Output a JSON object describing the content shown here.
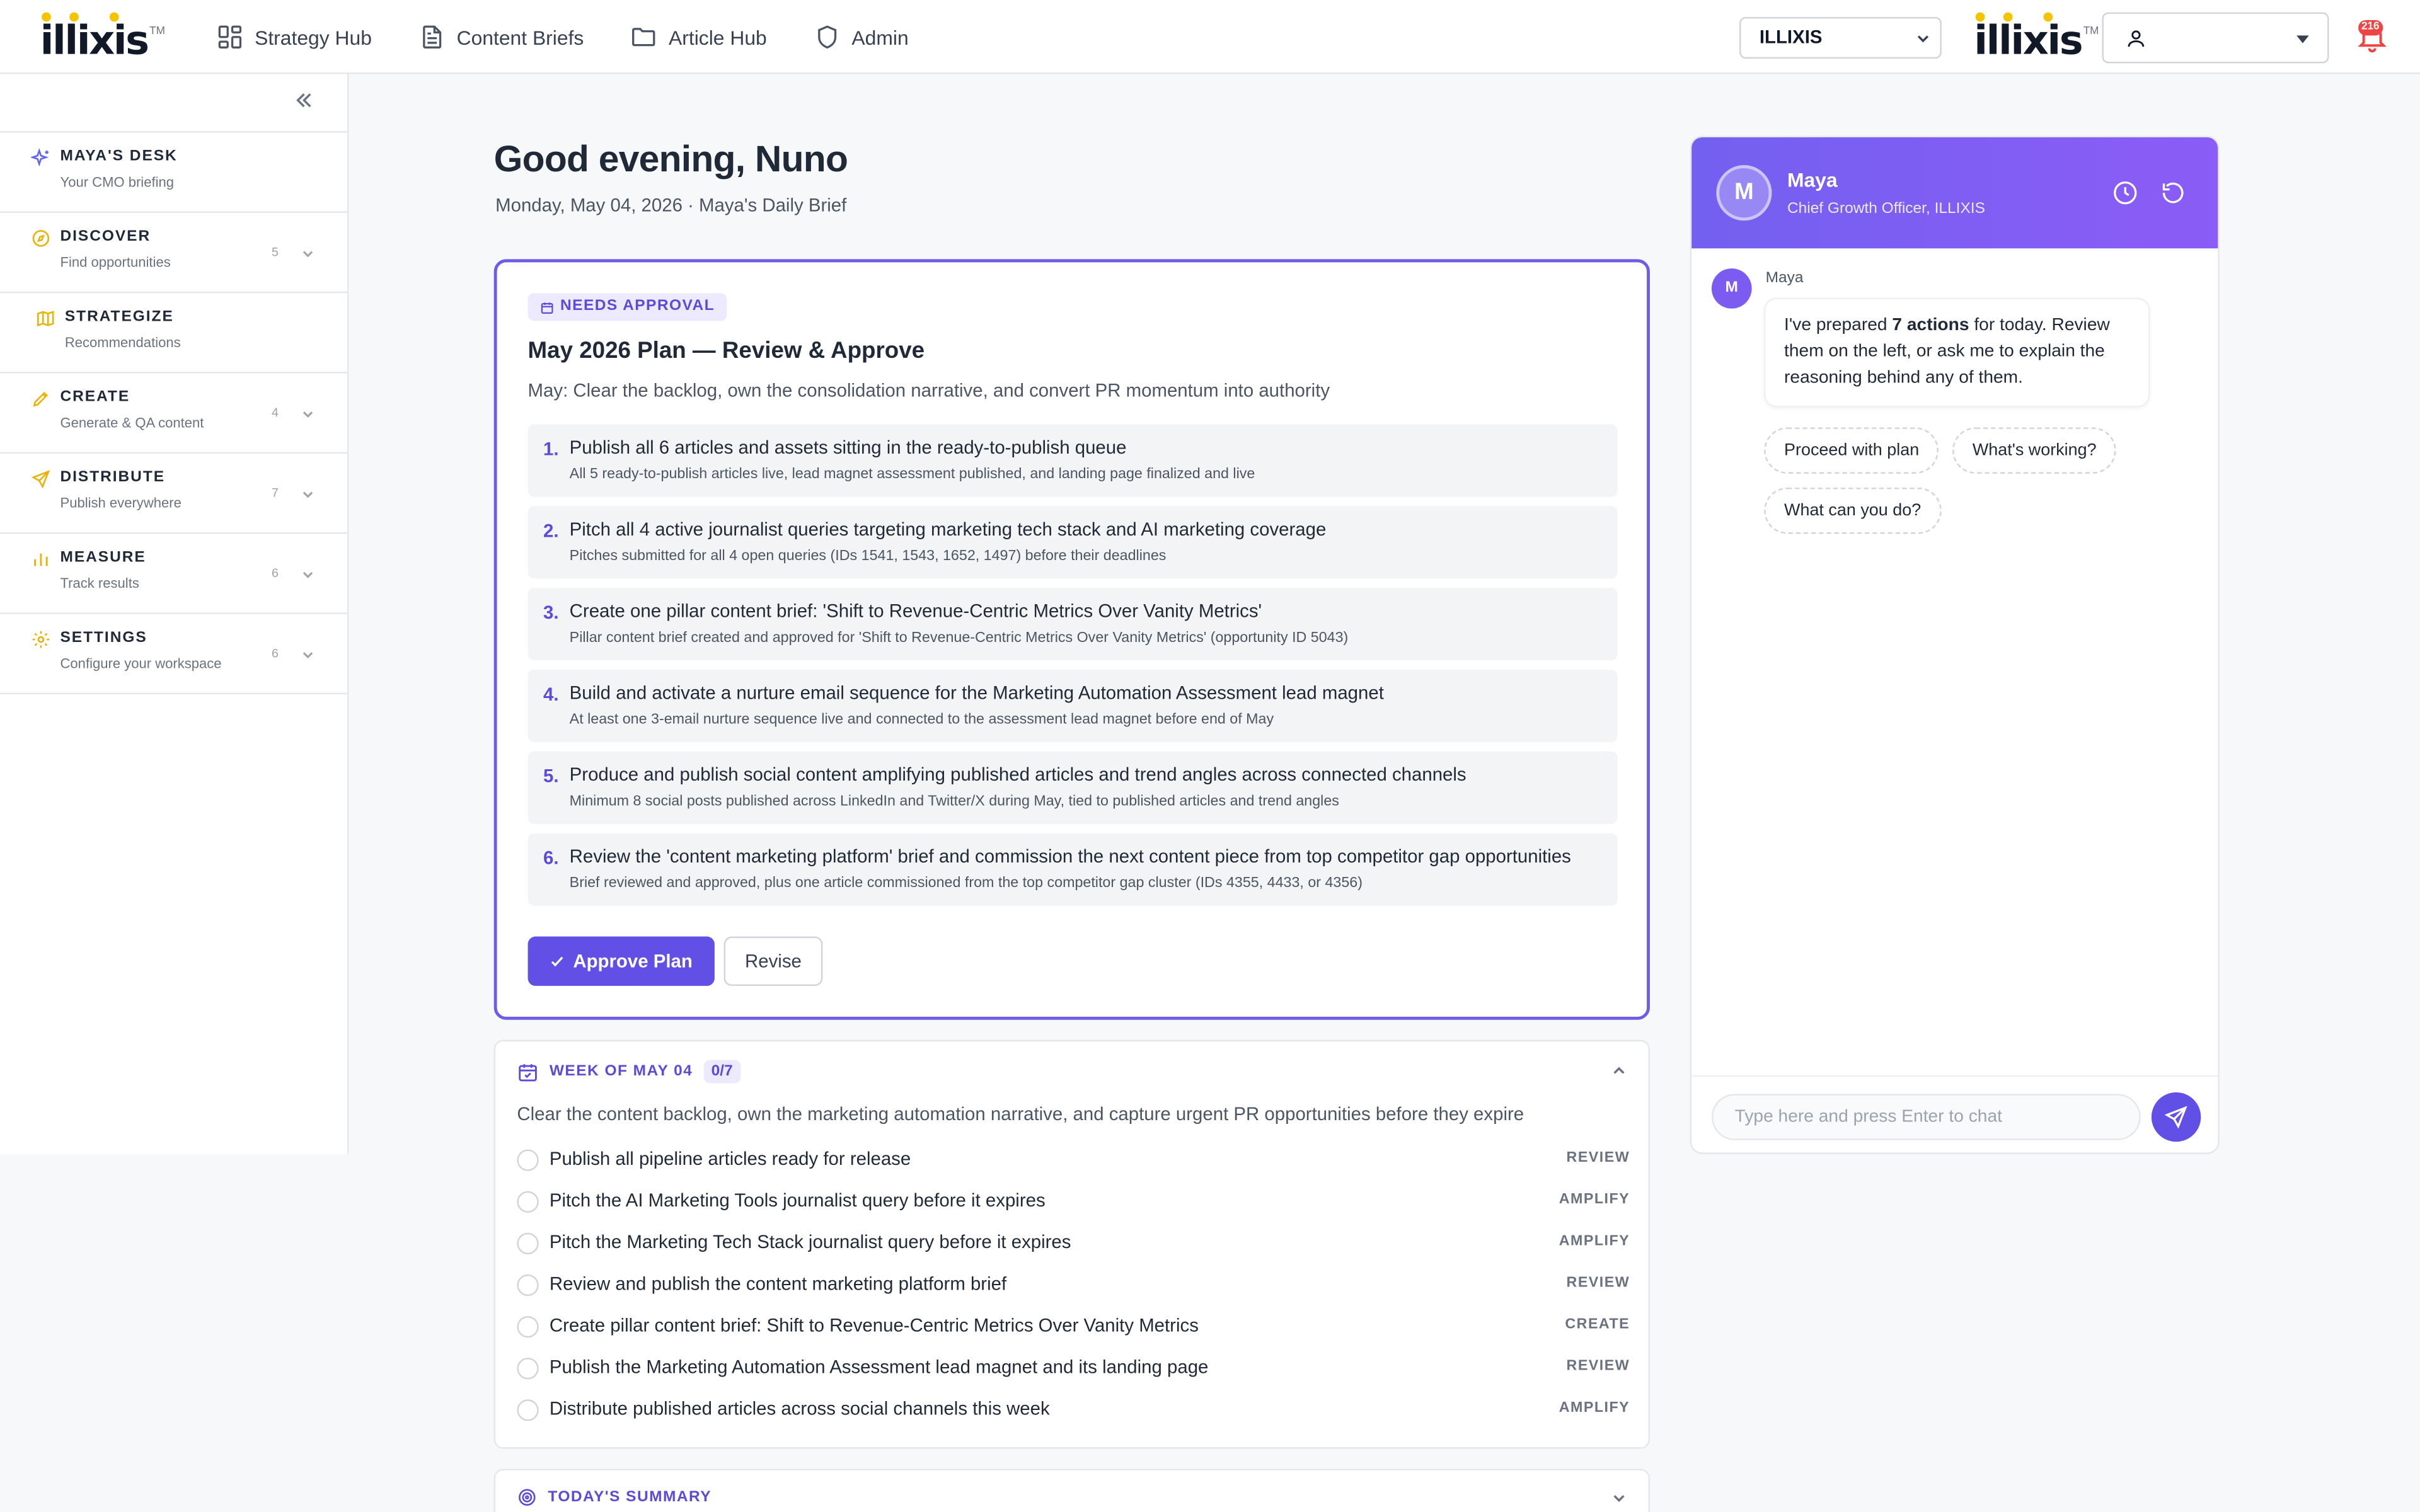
{
  "brand": {
    "logo_text": "illixis",
    "tm": "TM",
    "dot_color": "#f5c400",
    "accent": "#6250e6"
  },
  "nav": {
    "items": [
      {
        "label": "Strategy Hub",
        "icon": "grid-icon"
      },
      {
        "label": "Content Briefs",
        "icon": "document-icon"
      },
      {
        "label": "Article Hub",
        "icon": "folder-icon"
      },
      {
        "label": "Admin",
        "icon": "shield-icon"
      }
    ]
  },
  "header": {
    "org_select": "ILLIXIS",
    "notification_count": "216"
  },
  "sidebar": {
    "items": [
      {
        "title": "MAYA'S DESK",
        "subtitle": "Your CMO briefing",
        "count": "",
        "icon": "sparkle-icon"
      },
      {
        "title": "DISCOVER",
        "subtitle": "Find opportunities",
        "count": "5",
        "icon": "compass-icon"
      },
      {
        "title": "STRATEGIZE",
        "subtitle": "Recommendations",
        "count": "",
        "icon": "map-icon"
      },
      {
        "title": "CREATE",
        "subtitle": "Generate & QA content",
        "count": "4",
        "icon": "pen-icon"
      },
      {
        "title": "DISTRIBUTE",
        "subtitle": "Publish everywhere",
        "count": "7",
        "icon": "send-icon"
      },
      {
        "title": "MEASURE",
        "subtitle": "Track results",
        "count": "6",
        "icon": "bar-chart-icon"
      },
      {
        "title": "SETTINGS",
        "subtitle": "Configure your workspace",
        "count": "6",
        "icon": "gear-icon"
      }
    ]
  },
  "main": {
    "greeting": "Good evening, Nuno",
    "dateline": "Monday, May 04, 2026 · Maya's Daily Brief",
    "plan": {
      "badge": "NEEDS APPROVAL",
      "title": "May 2026 Plan — Review & Approve",
      "subtitle": "May: Clear the backlog, own the consolidation narrative, and convert PR momentum into authority",
      "items": [
        {
          "num": "1.",
          "title": "Publish all 6 articles and assets sitting in the ready-to-publish queue",
          "desc": "All 5 ready-to-publish articles live, lead magnet assessment published, and landing page finalized and live"
        },
        {
          "num": "2.",
          "title": "Pitch all 4 active journalist queries targeting marketing tech stack and AI marketing coverage",
          "desc": "Pitches submitted for all 4 open queries (IDs 1541, 1543, 1652, 1497) before their deadlines"
        },
        {
          "num": "3.",
          "title": "Create one pillar content brief: 'Shift to Revenue-Centric Metrics Over Vanity Metrics'",
          "desc": "Pillar content brief created and approved for 'Shift to Revenue-Centric Metrics Over Vanity Metrics' (opportunity ID 5043)"
        },
        {
          "num": "4.",
          "title": "Build and activate a nurture email sequence for the Marketing Automation Assessment lead magnet",
          "desc": "At least one 3-email nurture sequence live and connected to the assessment lead magnet before end of May"
        },
        {
          "num": "5.",
          "title": "Produce and publish social content amplifying published articles and trend angles across connected channels",
          "desc": "Minimum 8 social posts published across LinkedIn and Twitter/X during May, tied to published articles and trend angles"
        },
        {
          "num": "6.",
          "title": "Review the 'content marketing platform' brief and commission the next content piece from top competitor gap opportunities",
          "desc": "Brief reviewed and approved, plus one article commissioned from the top competitor gap cluster (IDs 4355, 4433, or 4356)"
        }
      ],
      "approve_label": "Approve Plan",
      "revise_label": "Revise"
    },
    "week": {
      "title": "WEEK OF MAY 04",
      "count": "0/7",
      "desc": "Clear the content backlog, own the marketing automation narrative, and capture urgent PR opportunities before they expire",
      "tasks": [
        {
          "label": "Publish all pipeline articles ready for release",
          "tag": "REVIEW"
        },
        {
          "label": "Pitch the AI Marketing Tools journalist query before it expires",
          "tag": "AMPLIFY"
        },
        {
          "label": "Pitch the Marketing Tech Stack journalist query before it expires",
          "tag": "AMPLIFY"
        },
        {
          "label": "Review and publish the content marketing platform brief",
          "tag": "REVIEW"
        },
        {
          "label": "Create pillar content brief: Shift to Revenue-Centric Metrics Over Vanity Metrics",
          "tag": "CREATE"
        },
        {
          "label": "Publish the Marketing Automation Assessment lead magnet and its landing page",
          "tag": "REVIEW"
        },
        {
          "label": "Distribute published articles across social channels this week",
          "tag": "AMPLIFY"
        }
      ]
    },
    "summary": {
      "title": "TODAY'S SUMMARY"
    }
  },
  "chat": {
    "avatar_letter": "M",
    "name": "Maya",
    "role": "Chief Growth Officer, ILLIXIS",
    "message": {
      "sender": "Maya",
      "pre": "I've prepared ",
      "bold": "7 actions",
      "post": " for today. Review them on the left, or ask me to explain the reasoning behind any of them."
    },
    "chips": [
      "Proceed with plan",
      "What's working?",
      "What can you do?"
    ],
    "input_placeholder": "Type here and press Enter to chat"
  }
}
